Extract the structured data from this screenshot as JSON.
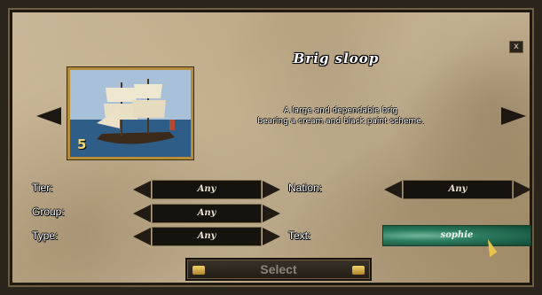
{
  "dialog": {
    "title": "Brig sloop",
    "close_label": "x",
    "description_line1": "A large and dependable brig",
    "description_line2": "bearing a cream and black paint scheme.",
    "tier_badge": "5"
  },
  "filters": {
    "tier": {
      "label": "Tier:",
      "value": "Any"
    },
    "group": {
      "label": "Group:",
      "value": "Any"
    },
    "type": {
      "label": "Type:",
      "value": "Any"
    },
    "nation": {
      "label": "Nation:",
      "value": "Any"
    },
    "text": {
      "label": "Text:",
      "value": "sophie"
    }
  },
  "actions": {
    "select_label": "Select"
  },
  "colors": {
    "parchment": "#bba987",
    "frame": "#2b241b",
    "gold": "#b58c3a",
    "text_field_green": "#2c7b5f"
  }
}
